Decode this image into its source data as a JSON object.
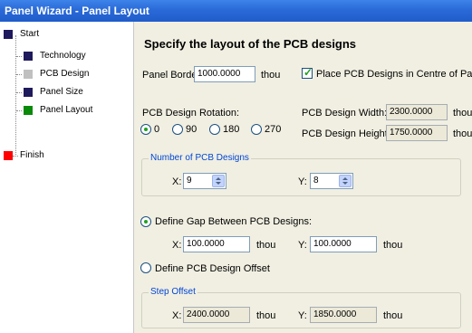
{
  "window": {
    "title": "Panel Wizard - Panel Layout"
  },
  "steps": [
    {
      "label": "Start",
      "color": "#1f1a5c"
    },
    {
      "label": "Technology",
      "color": "#1f1a5c"
    },
    {
      "label": "PCB Design",
      "color": "#c0c0c0"
    },
    {
      "label": "Panel Size",
      "color": "#1f1a5c"
    },
    {
      "label": "Panel Layout",
      "color": "#0a8a0a"
    },
    {
      "label": "Finish",
      "color": "#ff0000"
    }
  ],
  "main": {
    "heading": "Specify the layout of the PCB designs",
    "panel_border": {
      "label": "Panel Border:",
      "value": "1000.0000",
      "unit": "thou"
    },
    "center_checkbox": {
      "label": "Place PCB Designs in Centre of Panel",
      "checked": true
    },
    "rotation": {
      "label": "PCB Design Rotation:",
      "options": [
        "0",
        "90",
        "180",
        "270"
      ],
      "selected": "0"
    },
    "design_width": {
      "label": "PCB Design Width:",
      "value": "2300.0000",
      "unit": "thou"
    },
    "design_height": {
      "label": "PCB Design Height:",
      "value": "1750.0000",
      "unit": "thou"
    },
    "number_group": {
      "title": "Number of PCB Designs",
      "x_label": "X:",
      "x_value": "9",
      "y_label": "Y:",
      "y_value": "8"
    },
    "gap": {
      "label": "Define Gap Between PCB Designs:",
      "selected": true,
      "x_label": "X:",
      "x_value": "100.0000",
      "x_unit": "thou",
      "y_label": "Y:",
      "y_value": "100.0000",
      "y_unit": "thou"
    },
    "offset": {
      "label": "Define PCB Design Offset",
      "selected": false
    },
    "step_offset": {
      "title": "Step Offset",
      "x_label": "X:",
      "x_value": "2400.0000",
      "x_unit": "thou",
      "y_label": "Y:",
      "y_value": "1850.0000",
      "y_unit": "thou"
    }
  }
}
